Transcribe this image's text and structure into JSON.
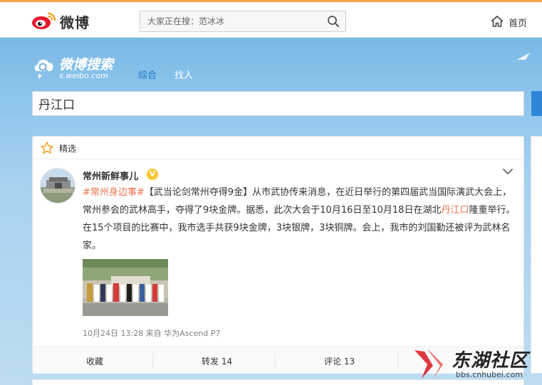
{
  "header": {
    "logo_text": "微博",
    "search_placeholder": "大家正在搜：范冰冰",
    "home_label": "首页"
  },
  "search_page": {
    "logo_title": "微博搜索",
    "logo_sub": "s.weibo.com",
    "tabs": [
      {
        "label": "综合",
        "active": true
      },
      {
        "label": "找人",
        "active": false
      }
    ],
    "query": "丹江口"
  },
  "featured": {
    "label": "精选",
    "post": {
      "user": "常州新鲜事儿",
      "verified_badge": "V",
      "hashtag": "#常州身边事#",
      "text_1": "【武当论剑常州夺得9金】从市武协传来消息，在近日举行的第四届武当国际演武大会上，常州参会的武林高手，夺得了9块金牌。据悉，此次大会于10月16日至10月18日在湖北",
      "keyword": "丹江口",
      "text_2": "隆重举行。在15个项目的比赛中，我市选手共获9块金牌，3块银牌，3块铜牌。会上，我市的刘国勤还被评为武林名家。",
      "meta": "10月24日 13:28 来自 华为Ascend P7",
      "actions": {
        "favorite": "收藏",
        "forward": "转发 14",
        "comment": "评论 13"
      }
    }
  },
  "watermark": {
    "text": "东湖社区",
    "url": "bbs.cnhubei.com"
  },
  "colors": {
    "accent_blue": "#1e78c8",
    "highlight_orange": "#eb7350",
    "verified_yellow": "#ffc62a",
    "watermark_red": "#d8232a"
  }
}
